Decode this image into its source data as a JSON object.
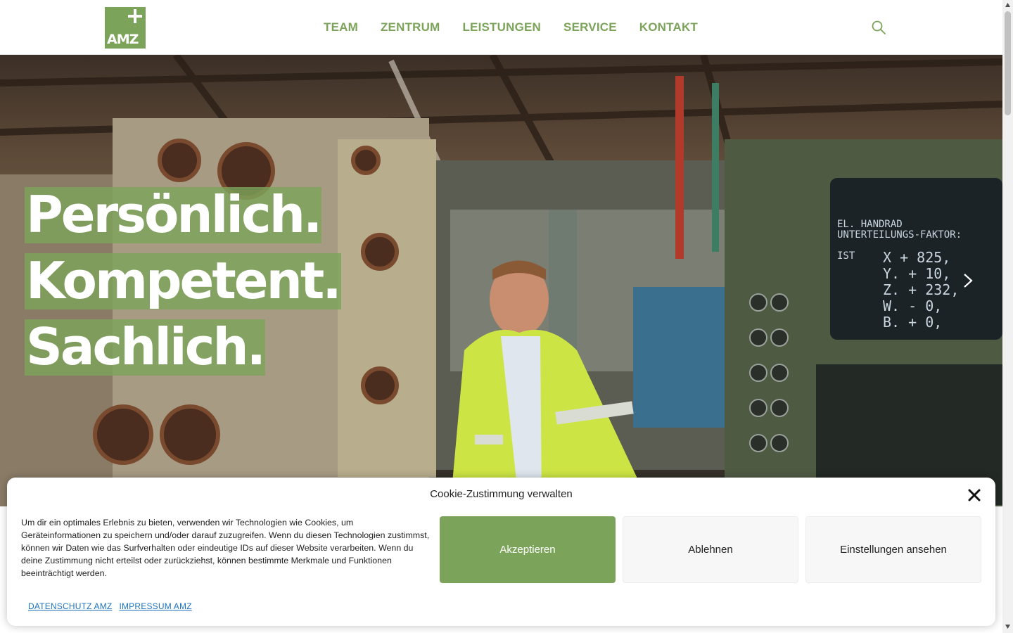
{
  "header": {
    "logo_text": "AMZ",
    "nav": [
      {
        "label": "TEAM"
      },
      {
        "label": "ZENTRUM"
      },
      {
        "label": "LEISTUNGEN"
      },
      {
        "label": "SERVICE"
      },
      {
        "label": "KONTAKT"
      }
    ],
    "search_icon": "search-icon"
  },
  "hero": {
    "headline": [
      "Persönlich.",
      "Kompetent.",
      "Sachlich."
    ],
    "next_icon": "chevron-right-icon"
  },
  "cookie": {
    "title": "Cookie-Zustimmung verwalten",
    "text": "Um dir ein optimales Erlebnis zu bieten, verwenden wir Technologien wie Cookies, um Geräteinformationen zu speichern und/oder darauf zuzugreifen. Wenn du diesen Technologien zustimmst, können wir Daten wie das Surfverhalten oder eindeutige IDs auf dieser Website verarbeiten. Wenn du deine Zustimmung nicht erteilst oder zurückziehst, können bestimmte Merkmale und Funktionen beeinträchtigt werden.",
    "accept_label": "Akzeptieren",
    "deny_label": "Ablehnen",
    "settings_label": "Einstellungen ansehen",
    "links": [
      {
        "label": "Datenschutz AMZ"
      },
      {
        "label": "Impressum AMZ"
      }
    ],
    "close_icon": "close-icon"
  },
  "colors": {
    "brand_green": "#7ca35a",
    "link_blue": "#1e73be"
  }
}
